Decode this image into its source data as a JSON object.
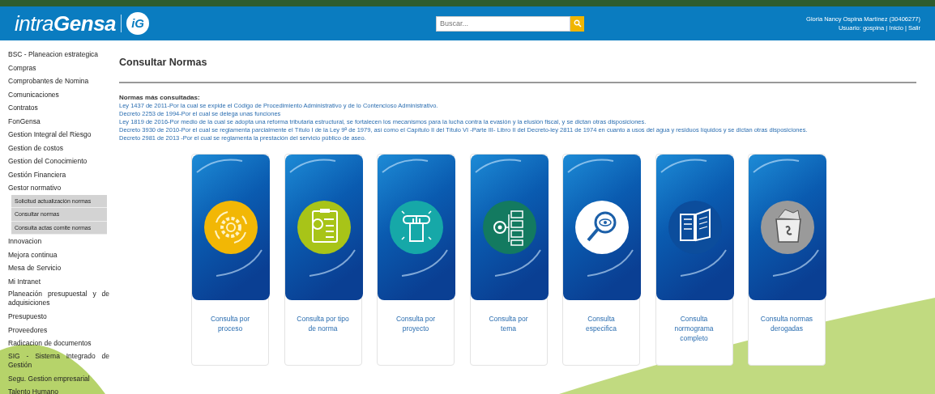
{
  "header": {
    "logo": "intra**Gensa**",
    "logo_badge": "iG",
    "search": {
      "placeholder": "Buscar..."
    },
    "user_name": "Gloria Nancy Ospina Martínez (30406277)",
    "user_label": "Usuario: gospina",
    "links": [
      "Inicio",
      "Salir"
    ],
    "separator": "|"
  },
  "sidebar": {
    "items": [
      {
        "label": "BSC - Planeacion estrategica"
      },
      {
        "label": "Compras"
      },
      {
        "label": "Comprobantes de Nomina"
      },
      {
        "label": "Comunicaciones"
      },
      {
        "label": "Contratos"
      },
      {
        "label": "FonGensa"
      },
      {
        "label": "Gestion Integral del Riesgo"
      },
      {
        "label": "Gestion de costos"
      },
      {
        "label": "Gestion del Conocimiento"
      },
      {
        "label": "Gestión Financiera"
      },
      {
        "label": "Gestor normativo",
        "children": [
          {
            "label": "Solicitud actualización normas"
          },
          {
            "label": "Consultar normas"
          },
          {
            "label": "Consulta actas comite normas"
          }
        ]
      },
      {
        "label": "Innovacion"
      },
      {
        "label": "Mejora continua"
      },
      {
        "label": "Mesa de Servicio"
      },
      {
        "label": "Mi Intranet"
      },
      {
        "label": "Planeación presupuestal y de adquisiciones"
      },
      {
        "label": "Presupuesto"
      },
      {
        "label": "Proveedores"
      },
      {
        "label": "Radicacion de documentos"
      },
      {
        "label": "SIG - Sistema Integrado de Gestión"
      },
      {
        "label": "Segu. Gestion empresarial"
      },
      {
        "label": "Talento Humano"
      }
    ]
  },
  "page": {
    "title": "Consultar Normas",
    "most_consulted_label": "Normas más consultadas:",
    "norms": [
      "Ley 1437 de 2011-Por la cual se expide el Código de Procedimiento Administrativo y de lo Contencioso Administrativo.",
      "Decreto 2253 de 1994-Por el cual se delega unas funciones",
      "Ley 1819 de 2016-Por medio de la cual se adopta una reforma tributaria estructural, se fortalecen los mecanismos para la lucha contra la evasión y la elusión fiscal, y se dictan otras disposiciones.",
      "Decreto 3930 de 2010-Por el cual se reglamenta parcialmente el Título I de la Ley 9ª de 1979, así como el Capítulo II del Título VI -Parte III- Libro II del Decreto-ley 2811 de 1974 en cuanto a usos del agua y residuos líquidos y se dictan otras disposiciones.",
      "Decreto 2981 de 2013 -Por el cual se reglamenta la prestación del servicio público de aseo."
    ],
    "cards": [
      {
        "label": "Consulta por proceso",
        "kind": "process",
        "color": "#f2b705"
      },
      {
        "label": "Consulta por tipo de norma",
        "kind": "checklist",
        "color": "#a8c418"
      },
      {
        "label": "Consulta por proyecto",
        "kind": "scroll",
        "color": "#16a8a8"
      },
      {
        "label": "Consulta por tema",
        "kind": "topics",
        "color": "#137a60"
      },
      {
        "label": "Consulta especifica",
        "kind": "search",
        "color": "#ffffff"
      },
      {
        "label": "Consulta normograma completo",
        "kind": "book",
        "color": "#0c4d9c"
      },
      {
        "label": "Consulta normas derogadas",
        "kind": "bin",
        "color": "#9a9a9a"
      }
    ]
  }
}
